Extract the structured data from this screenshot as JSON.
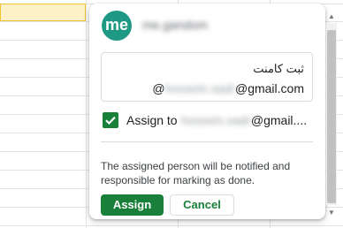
{
  "comment": {
    "avatar_initials": "me",
    "author_name": "me.gandom",
    "text_line1": "ثبت کامنت",
    "mention_prefix": "@",
    "mention_redacted": "hossein.sadr",
    "mention_domain": "@gmail.com",
    "assign_checked": true,
    "assign_label": "Assign to",
    "assign_redacted": "hossein.sadr",
    "assign_domain": "@gmail....",
    "notice": "The assigned person will be notified and responsible for marking as done.",
    "assign_button": "Assign",
    "cancel_button": "Cancel"
  },
  "colors": {
    "accent": "#188038",
    "avatar": "#1e9a84",
    "selected_cell": "#fdf2c7",
    "selected_cell_border": "#f1c232"
  }
}
